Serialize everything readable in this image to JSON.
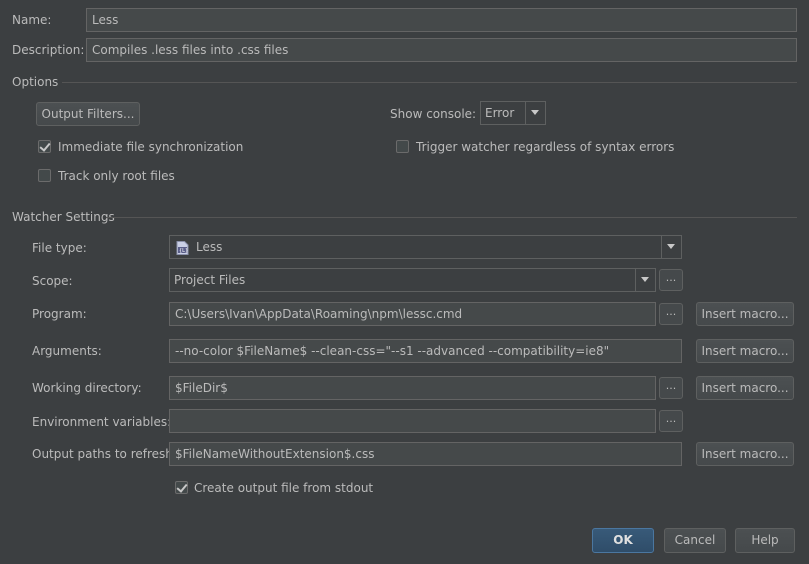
{
  "name": {
    "label": "Name:",
    "value": "Less"
  },
  "description": {
    "label": "Description:",
    "value": "Compiles .less files into .css files"
  },
  "options": {
    "section_title": "Options",
    "output_filters_button": "Output Filters...",
    "show_console": {
      "label": "Show console:",
      "value": "Error"
    },
    "immediate_sync": {
      "label": "Immediate file synchronization",
      "checked": true
    },
    "trigger_watcher": {
      "label": "Trigger watcher regardless of syntax errors",
      "checked": false
    },
    "track_root": {
      "label": "Track only root files",
      "checked": false
    }
  },
  "watcher": {
    "section_title": "Watcher Settings",
    "file_type": {
      "label": "File type:",
      "value": "Less",
      "icon": "less-file-icon"
    },
    "scope": {
      "label": "Scope:",
      "value": "Project Files"
    },
    "program": {
      "label": "Program:",
      "value": "C:\\Users\\Ivan\\AppData\\Roaming\\npm\\lessc.cmd"
    },
    "arguments": {
      "label": "Arguments:",
      "value": "--no-color $FileName$  --clean-css=\"--s1 --advanced --compatibility=ie8\""
    },
    "working_directory": {
      "label": "Working directory:",
      "value": "$FileDir$"
    },
    "env_vars": {
      "label": "Environment variables:",
      "value": ""
    },
    "output_paths": {
      "label": "Output paths to refresh:",
      "value": "$FileNameWithoutExtension$.css"
    },
    "create_output": {
      "label": "Create output file from stdout",
      "checked": true
    },
    "insert_macro_label": "Insert macro...",
    "ellipsis_label": "..."
  },
  "footer": {
    "ok": "OK",
    "cancel": "Cancel",
    "help": "Help"
  },
  "colors": {
    "background": "#3c3f41",
    "text": "#bbbbbb",
    "field": "#45494a",
    "primary": "#365880"
  }
}
